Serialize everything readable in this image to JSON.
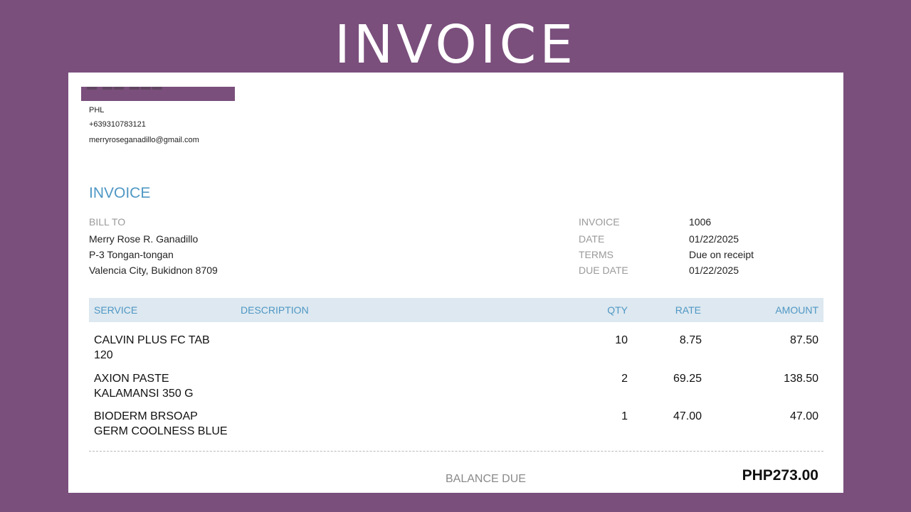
{
  "slide": {
    "title": "INVOICE"
  },
  "company": {
    "country": "PHL",
    "phone": "+639310783121",
    "email": "merryroseganadillo@gmail.com"
  },
  "invoice": {
    "heading": "INVOICE",
    "bill_to": {
      "label": "BILL TO",
      "name": "Merry Rose R. Ganadillo",
      "address1": "P-3 Tongan-tongan",
      "address2": "Valencia City, Bukidnon  8709"
    },
    "meta": [
      {
        "label": "INVOICE",
        "value": "1006"
      },
      {
        "label": "DATE",
        "value": "01/22/2025"
      },
      {
        "label": "TERMS",
        "value": "Due on receipt"
      },
      {
        "label": "DUE DATE",
        "value": "01/22/2025"
      }
    ],
    "table": {
      "headers": {
        "service": "SERVICE",
        "description": "DESCRIPTION",
        "qty": "QTY",
        "rate": "RATE",
        "amount": "AMOUNT"
      },
      "rows": [
        {
          "service_line1": "CALVIN PLUS FC TAB",
          "service_line2": "120",
          "qty": "10",
          "rate": "8.75",
          "amount": "87.50"
        },
        {
          "service_line1": "AXION PASTE",
          "service_line2": "KALAMANSI 350 G",
          "qty": "2",
          "rate": "69.25",
          "amount": "138.50"
        },
        {
          "service_line1": "BIODERM BRSOAP",
          "service_line2": "GERM COOLNESS BLUE",
          "qty": "1",
          "rate": "47.00",
          "amount": "47.00"
        }
      ]
    },
    "balance": {
      "label": "BALANCE DUE",
      "value": "PHP273.00"
    }
  },
  "colors": {
    "background": "#7a4f7c",
    "accent": "#4f97c4",
    "header_fill": "#dde8f0"
  }
}
